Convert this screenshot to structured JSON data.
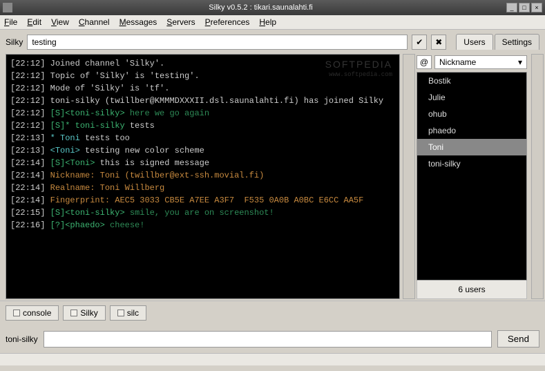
{
  "window": {
    "title": "Silky v0.5.2 : tikari.saunalahti.fi"
  },
  "menu": {
    "file": "File",
    "edit": "Edit",
    "view": "View",
    "channel": "Channel",
    "messages": "Messages",
    "servers": "Servers",
    "preferences": "Preferences",
    "help": "Help"
  },
  "topic": {
    "label": "Silky",
    "value": "testing"
  },
  "side_tabs": {
    "users": "Users",
    "settings": "Settings"
  },
  "users": {
    "at": "@",
    "header": "Nickname",
    "list": [
      "Bostik",
      "Julie",
      "ohub",
      "phaedo",
      "Toni",
      "toni-silky"
    ],
    "selected": "Toni",
    "count": "6 users"
  },
  "watermark": {
    "big": "SOFTPEDIA",
    "small": "www.softpedia.com"
  },
  "chat": [
    {
      "ts": "[22:12]",
      "parts": [
        {
          "t": " Joined channel 'Silky'.",
          "c": ""
        }
      ]
    },
    {
      "ts": "[22:12]",
      "parts": [
        {
          "t": " Topic of 'Silky' is 'testing'.",
          "c": ""
        }
      ]
    },
    {
      "ts": "[22:12]",
      "parts": [
        {
          "t": " Mode of 'Silky' is 'tf'.",
          "c": ""
        }
      ]
    },
    {
      "ts": "[22:12]",
      "parts": [
        {
          "t": " toni-silky (twillber@KMMMDXXXII.dsl.saunalahti.fi) has joined Silky",
          "c": ""
        }
      ]
    },
    {
      "ts": "[22:12]",
      "parts": [
        {
          "t": " [S]<toni-silky>",
          "c": "green"
        },
        {
          "t": " here we go again",
          "c": "dgreen"
        }
      ]
    },
    {
      "ts": "[22:12]",
      "parts": [
        {
          "t": " [S]* toni-silky",
          "c": "green"
        },
        {
          "t": " tests",
          "c": ""
        }
      ]
    },
    {
      "ts": "[22:13]",
      "parts": [
        {
          "t": " * Toni",
          "c": "cyan"
        },
        {
          "t": " tests too",
          "c": ""
        }
      ]
    },
    {
      "ts": "[22:13]",
      "parts": [
        {
          "t": " <Toni>",
          "c": "cyan"
        },
        {
          "t": " testing new color scheme",
          "c": ""
        }
      ]
    },
    {
      "ts": "[22:14]",
      "parts": [
        {
          "t": " [S]<Toni>",
          "c": "green"
        },
        {
          "t": " this is signed message",
          "c": ""
        }
      ]
    },
    {
      "ts": "[22:14]",
      "parts": [
        {
          "t": " Nickname: Toni (twillber@ext-ssh.movial.fi)",
          "c": "brown"
        }
      ]
    },
    {
      "ts": "[22:14]",
      "parts": [
        {
          "t": " Realname: Toni Willberg",
          "c": "brown"
        }
      ]
    },
    {
      "ts": "[22:14]",
      "parts": [
        {
          "t": " Fingerprint: AEC5 3033 CB5E A7EE A3F7  F535 0A0B A0BC E6CC AA5F",
          "c": "brown"
        }
      ]
    },
    {
      "ts": "[22:15]",
      "parts": [
        {
          "t": " [S]<toni-silky>",
          "c": "green"
        },
        {
          "t": " smile, you are on screenshot!",
          "c": "dgreen"
        }
      ]
    },
    {
      "ts": "[22:16]",
      "parts": [
        {
          "t": " [?]<phaedo>",
          "c": "green"
        },
        {
          "t": " cheese!",
          "c": "dgreen"
        }
      ]
    }
  ],
  "bottom_tabs": {
    "console": "console",
    "silky": "Silky",
    "silc": "silc"
  },
  "input": {
    "nick": "toni-silky",
    "send": "Send",
    "value": ""
  }
}
